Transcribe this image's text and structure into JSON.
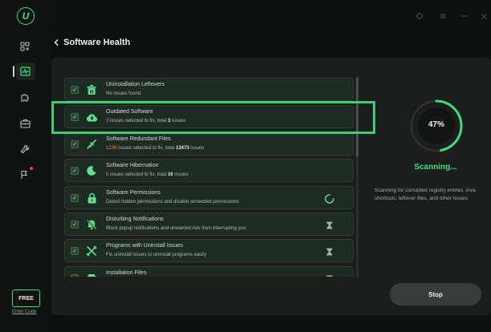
{
  "app": {
    "logo_letter": "U"
  },
  "sidebar": {
    "items": [
      {
        "icon": "apps-grid-icon"
      },
      {
        "icon": "health-monitor-icon",
        "active": true
      },
      {
        "icon": "puzzle-icon"
      },
      {
        "icon": "toolbox-icon"
      },
      {
        "icon": "wrench-icon"
      },
      {
        "icon": "flag-icon",
        "badge": "red-dot"
      }
    ],
    "free_label": "FREE",
    "enter_code_label": "Enter Code"
  },
  "topbar": {
    "icons": [
      "target-icon",
      "menu-icon",
      "minimize-icon",
      "close-icon"
    ]
  },
  "header": {
    "title": "Software Health"
  },
  "items": [
    {
      "title": "Uninstallation Leftovers",
      "desc": "No issues found",
      "icon": "trash-icon"
    },
    {
      "title": "Outdated Software",
      "desc_count": "3",
      "desc_mid": " issues selected to fix, total ",
      "desc_total": "3",
      "desc_end": " issues",
      "icon": "cloud-update-icon"
    },
    {
      "title": "Software Redundant Files",
      "desc_count": "1236",
      "desc_mid": " issues selected to fix, total ",
      "desc_total": "13473",
      "desc_end": " issues",
      "icon": "broom-icon"
    },
    {
      "title": "Software Hibernation",
      "desc_count": "0",
      "desc_mid": " issues selected to fix, total ",
      "desc_total": "16",
      "desc_end": " issues",
      "icon": "moon-icon"
    },
    {
      "title": "Software Permissions",
      "desc": "Detect hidden permissions and disable unneeded permissions",
      "icon": "lock-icon",
      "status": "scanning"
    },
    {
      "title": "Disturbing Notifications",
      "desc": "Block popup notifications and unwanted Ads from interrupting you",
      "icon": "bell-off-icon",
      "status": "waiting"
    },
    {
      "title": "Programs with Uninstall Issues",
      "desc": "Fix uninstall issues to uninstall programs easily",
      "icon": "tools-icon",
      "status": "waiting"
    },
    {
      "title": "Installation Files",
      "desc": "",
      "icon": "package-icon",
      "status": "waiting"
    }
  ],
  "scan": {
    "progress": 47,
    "progress_label": "47%",
    "status": "Scanning...",
    "desc_line1": "Scanning for corrupted registry entries, inva",
    "desc_line2": "shortcuts, leftover files, and other issues",
    "stop_label": "Stop"
  },
  "colors": {
    "accent": "#3ee07a",
    "highlight_orange": "#f07c3e"
  }
}
